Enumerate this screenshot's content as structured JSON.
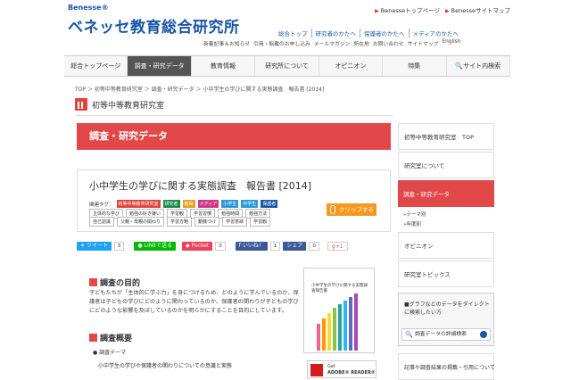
{
  "header": {
    "brand": "Benesse®",
    "title": "ベネッセ教育総合研究所",
    "top_links": [
      "Benesseトップページ",
      "Benesseサイトマップ"
    ],
    "subnav1": [
      "総合トップ",
      "研究者のかたへ",
      "保護者のかたへ",
      "メディアのかたへ"
    ],
    "subnav2": [
      "新着記事＆お知らせ",
      "引用・転載のお申し込み",
      "メールマガジン",
      "所在地",
      "お問い合わせ",
      "サイトマップ",
      "English"
    ]
  },
  "mainnav": [
    "総合トップページ",
    "調査・研究データ",
    "教育情報",
    "研究所について",
    "オピニオン",
    "特集",
    "サイト内検索"
  ],
  "breadcrumb": "TOP ＞ 初等中等教育研究室 ＞ 調査・研究データ ＞ 小中学生の学びに関する実態調査　報告書 [2014]",
  "section": "初等中等教育研究室",
  "banner": "調査・研究データ",
  "article": {
    "title": "小中学生の学びに関する実態調査　報告書 [2014]",
    "tags_label": "関連タグ：",
    "color_tags": [
      {
        "text": "初等中等教育研究室",
        "color": "#e0443c"
      },
      {
        "text": "研究者",
        "color": "#1a8a4a"
      },
      {
        "text": "教員",
        "color": "#e8a020"
      },
      {
        "text": "メディア",
        "color": "#d0388a"
      },
      {
        "text": "小学生",
        "color": "#2a9ad6"
      },
      {
        "text": "中学生",
        "color": "#2a9ad6"
      },
      {
        "text": "保護者",
        "color": "#1a56a6"
      }
    ],
    "row2": [
      "主体的な学び",
      "勉強の好き嫌い",
      "学習観",
      "学習習慣",
      "勉強時間",
      "勉強方法"
    ],
    "row3": [
      "自己認識",
      "父親・母親の関わり",
      "学習方略",
      "動機づけ",
      "学習意欲",
      "学習観"
    ],
    "clip": "クリップする"
  },
  "share": {
    "tweet": "ツイート",
    "tweet_count": "5",
    "line": "LINEで送る",
    "pocket": "Pocket",
    "pocket_count": "0",
    "like": "いいね！",
    "like_count": "1",
    "share": "シェア",
    "share_count": "0",
    "gplus": "g+1"
  },
  "body": {
    "h1": "調査の目的",
    "p1": "子どもたちが「主体的に学ぶ力」を身につけるため、どのように学んでいるのか、保護者は子どもの学びにどのように関わっているのか、保護者の関わりが子どもの学びにどのような影響を及ぼしているのかを明らかにすることを目的にしています。",
    "h2": "調査概要",
    "bullet": "● 調査テーマ",
    "theme": "小中学生の学びや保護者の関わりについての意識と実態",
    "book_title": "小中学生の学びに関する実態調査報告書",
    "pdf_get": "Get",
    "pdf_name": "ADOBE® READER®"
  },
  "sidebar": {
    "items": [
      "初等中等教育研究室　TOP",
      "研究室について",
      "調査・研究データ",
      "オピニオン",
      "研究室トピックス"
    ],
    "subs": [
      "»テーマ別",
      "»年度別"
    ],
    "box_text": "■グラフなどのデータをダイレクトに検索したい方",
    "search_btn": "調査データの詳細検索",
    "bottom": "記事や調査結果の掲載・引用について"
  }
}
